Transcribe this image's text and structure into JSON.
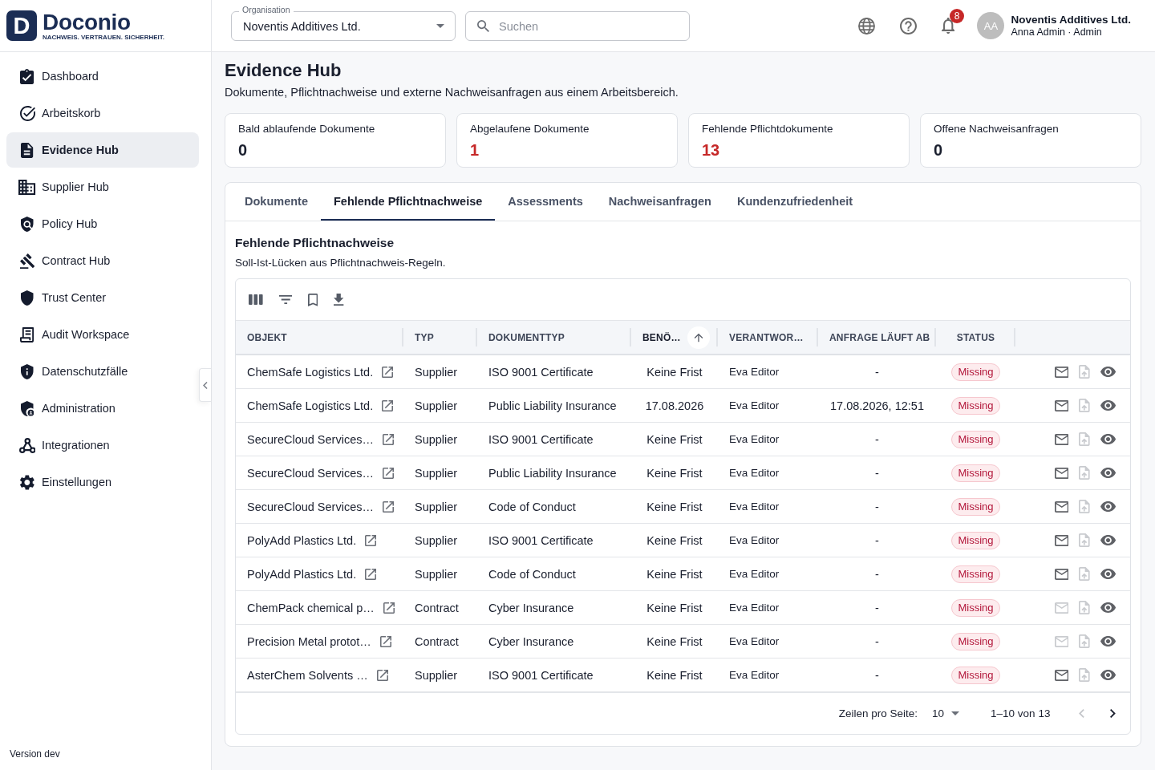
{
  "brand": {
    "mark": "D",
    "name": "Doconio",
    "tagline": "NACHWEIS. VERTRAUEN. SICHERHEIT."
  },
  "topbar": {
    "organisation": {
      "label": "Organisation",
      "value": "Noventis Additives Ltd."
    },
    "search": {
      "placeholder": "Suchen"
    },
    "notifications": {
      "count": "8"
    },
    "user": {
      "initials": "AA",
      "organisation": "Noventis Additives Ltd.",
      "name_role": "Anna Admin · Admin"
    }
  },
  "sidebar": {
    "items": [
      {
        "label": "Dashboard",
        "selected": false
      },
      {
        "label": "Arbeitskorb",
        "selected": false
      },
      {
        "label": "Evidence Hub",
        "selected": true
      },
      {
        "label": "Supplier Hub",
        "selected": false
      },
      {
        "label": "Policy Hub",
        "selected": false
      },
      {
        "label": "Contract Hub",
        "selected": false
      },
      {
        "label": "Trust Center",
        "selected": false
      },
      {
        "label": "Audit Workspace",
        "selected": false
      },
      {
        "label": "Datenschutzfälle",
        "selected": false
      },
      {
        "label": "Administration",
        "selected": false
      },
      {
        "label": "Integrationen",
        "selected": false
      },
      {
        "label": "Einstellungen",
        "selected": false
      }
    ],
    "version": "Version dev"
  },
  "page": {
    "title": "Evidence Hub",
    "subtitle": "Dokumente, Pflichtnachweise und externe Nachweisanfragen aus einem Arbeitsbereich."
  },
  "stats": [
    {
      "label": "Bald ablaufende Dokumente",
      "value": "0",
      "alert": false
    },
    {
      "label": "Abgelaufene Dokumente",
      "value": "1",
      "alert": true
    },
    {
      "label": "Fehlende Pflichtdokumente",
      "value": "13",
      "alert": true
    },
    {
      "label": "Offene Nachweisanfragen",
      "value": "0",
      "alert": false
    }
  ],
  "tabs": [
    {
      "label": "Dokumente",
      "selected": false
    },
    {
      "label": "Fehlende Pflichtnachweise",
      "selected": true
    },
    {
      "label": "Assessments",
      "selected": false
    },
    {
      "label": "Nachweisanfragen",
      "selected": false
    },
    {
      "label": "Kundenzufriedenheit",
      "selected": false
    }
  ],
  "section": {
    "title": "Fehlende Pflichtnachweise",
    "subtitle": "Soll-Ist-Lücken aus Pflichtnachweis-Regeln."
  },
  "table": {
    "columns": [
      {
        "label": "OBJEKT",
        "kind": "link",
        "sorted": false
      },
      {
        "label": "TYP",
        "kind": "text",
        "sorted": false
      },
      {
        "label": "DOKUMENTTYP",
        "kind": "text",
        "sorted": false
      },
      {
        "label": "BENÖ…",
        "kind": "center",
        "sorted": true
      },
      {
        "label": "VERANTWOR…",
        "kind": "compact",
        "sorted": false
      },
      {
        "label": "ANFRAGE LÄUFT AB",
        "kind": "center",
        "sorted": false
      },
      {
        "label": "STATUS",
        "kind": "badge",
        "sorted": false
      }
    ],
    "rows": [
      {
        "cells": [
          "ChemSafe Logistics Ltd.",
          "Supplier",
          "ISO 9001 Certificate",
          "Keine Frist",
          "Eva Editor",
          "-",
          "Missing"
        ],
        "mail_disabled": false,
        "upload_disabled": true
      },
      {
        "cells": [
          "ChemSafe Logistics Ltd.",
          "Supplier",
          "Public Liability Insurance",
          "17.08.2026",
          "Eva Editor",
          "17.08.2026, 12:51",
          "Missing"
        ],
        "mail_disabled": false,
        "upload_disabled": true
      },
      {
        "cells": [
          "SecureCloud Services…",
          "Supplier",
          "ISO 9001 Certificate",
          "Keine Frist",
          "Eva Editor",
          "-",
          "Missing"
        ],
        "mail_disabled": false,
        "upload_disabled": true
      },
      {
        "cells": [
          "SecureCloud Services…",
          "Supplier",
          "Public Liability Insurance",
          "Keine Frist",
          "Eva Editor",
          "-",
          "Missing"
        ],
        "mail_disabled": false,
        "upload_disabled": true
      },
      {
        "cells": [
          "SecureCloud Services…",
          "Supplier",
          "Code of Conduct",
          "Keine Frist",
          "Eva Editor",
          "-",
          "Missing"
        ],
        "mail_disabled": false,
        "upload_disabled": true
      },
      {
        "cells": [
          "PolyAdd Plastics Ltd.",
          "Supplier",
          "ISO 9001 Certificate",
          "Keine Frist",
          "Eva Editor",
          "-",
          "Missing"
        ],
        "mail_disabled": false,
        "upload_disabled": true
      },
      {
        "cells": [
          "PolyAdd Plastics Ltd.",
          "Supplier",
          "Code of Conduct",
          "Keine Frist",
          "Eva Editor",
          "-",
          "Missing"
        ],
        "mail_disabled": false,
        "upload_disabled": true
      },
      {
        "cells": [
          "ChemPack chemical p…",
          "Contract",
          "Cyber Insurance",
          "Keine Frist",
          "Eva Editor",
          "-",
          "Missing"
        ],
        "mail_disabled": true,
        "upload_disabled": true
      },
      {
        "cells": [
          "Precision Metal protot…",
          "Contract",
          "Cyber Insurance",
          "Keine Frist",
          "Eva Editor",
          "-",
          "Missing"
        ],
        "mail_disabled": true,
        "upload_disabled": true
      },
      {
        "cells": [
          "AsterChem Solvents …",
          "Supplier",
          "ISO 9001 Certificate",
          "Keine Frist",
          "Eva Editor",
          "-",
          "Missing"
        ],
        "mail_disabled": false,
        "upload_disabled": true
      }
    ],
    "pagination": {
      "rows_per_page_label": "Zeilen pro Seite:",
      "rows_per_page": "10",
      "range": "1–10 von 13",
      "prev_disabled": true,
      "next_disabled": false
    }
  }
}
